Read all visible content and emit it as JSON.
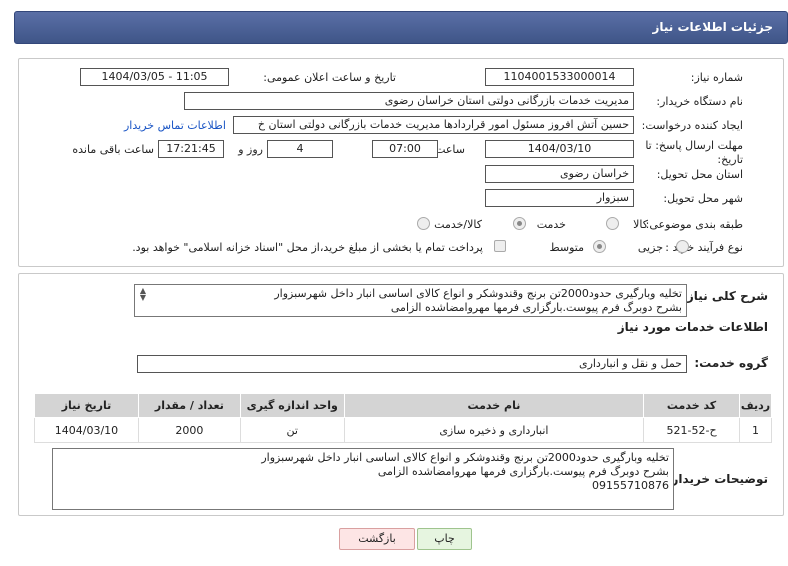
{
  "header": {
    "title": "جزئیات اطلاعات نیاز"
  },
  "fields": {
    "need_number_label": "شماره نیاز:",
    "need_number": "1104001533000014",
    "announce_label": "تاریخ و ساعت اعلان عمومی:",
    "announce_value": "1404/03/05 - 11:05",
    "buyer_org_label": "نام دستگاه خریدار:",
    "buyer_org": "مدیریت خدمات بازرگانی دولتی استان خراسان رضوی",
    "requester_label": "ایجاد کننده درخواست:",
    "requester": "حسین آتش افروز مسئول امور قراردادها مدیریت خدمات بازرگانی دولتی استان خ",
    "contact_link": "اطلاعات تماس خریدار",
    "deadline_label_1": "مهلت ارسال پاسخ: تا",
    "deadline_label_2": "تاریخ:",
    "deadline_date": "1404/03/10",
    "time_label": "ساعت",
    "deadline_time": "07:00",
    "days_value": "4",
    "days_label": "روز و",
    "remaining_time": "17:21:45",
    "remaining_label": "ساعت باقی مانده",
    "province_label": "استان محل تحویل:",
    "province": "خراسان رضوی",
    "city_label": "شهر محل تحویل:",
    "city": "سبزوار",
    "category_label": "طبقه بندی موضوعی:",
    "category_options": [
      "کالا",
      "خدمت",
      "کالا/خدمت"
    ],
    "category_selected": "خدمت",
    "process_label": "نوع فرآیند خرید :",
    "process_options": [
      "جزیی",
      "متوسط"
    ],
    "process_selected": "متوسط",
    "payment_note": "پرداخت تمام یا بخشی از مبلغ خرید،از محل \"اسناد خزانه اسلامی\" خواهد بود."
  },
  "summary": {
    "label": "شرح کلی نیاز:",
    "lines": [
      "تخلیه وبارگیری حدود2000تن برنج وقندوشکر و انواع کالای اساسی انبار داخل شهرسبزوار",
      "بشرح دوبرگ فرم پیوست.بارگزاری فرمها مهروامضاشده الزامی"
    ]
  },
  "services": {
    "section_title": "اطلاعات خدمات مورد نیاز",
    "group_label": "گروه خدمت:",
    "group_value": "حمل و نقل و انبارداری",
    "columns": [
      "ردیف",
      "کد خدمت",
      "نام خدمت",
      "واحد اندازه گیری",
      "تعداد / مقدار",
      "تاریخ نیاز"
    ],
    "rows": [
      [
        "1",
        "ح-52-521",
        "انبارداری و ذخیره سازی",
        "تن",
        "2000",
        "1404/03/10"
      ]
    ]
  },
  "buyer_notes": {
    "label": "توضیحات خریدار:",
    "lines": [
      "تخلیه وبارگیری حدود2000تن برنج وقندوشکر و انواع کالای اساسی انبار داخل شهرسبزوار",
      "بشرح دوبرگ فرم پیوست.بارگزاری فرمها مهروامضاشده الزامی",
      "09155710876"
    ]
  },
  "buttons": {
    "print": "چاپ",
    "back": "بازگشت"
  },
  "watermark": {
    "text": "AriaTender.neT"
  }
}
